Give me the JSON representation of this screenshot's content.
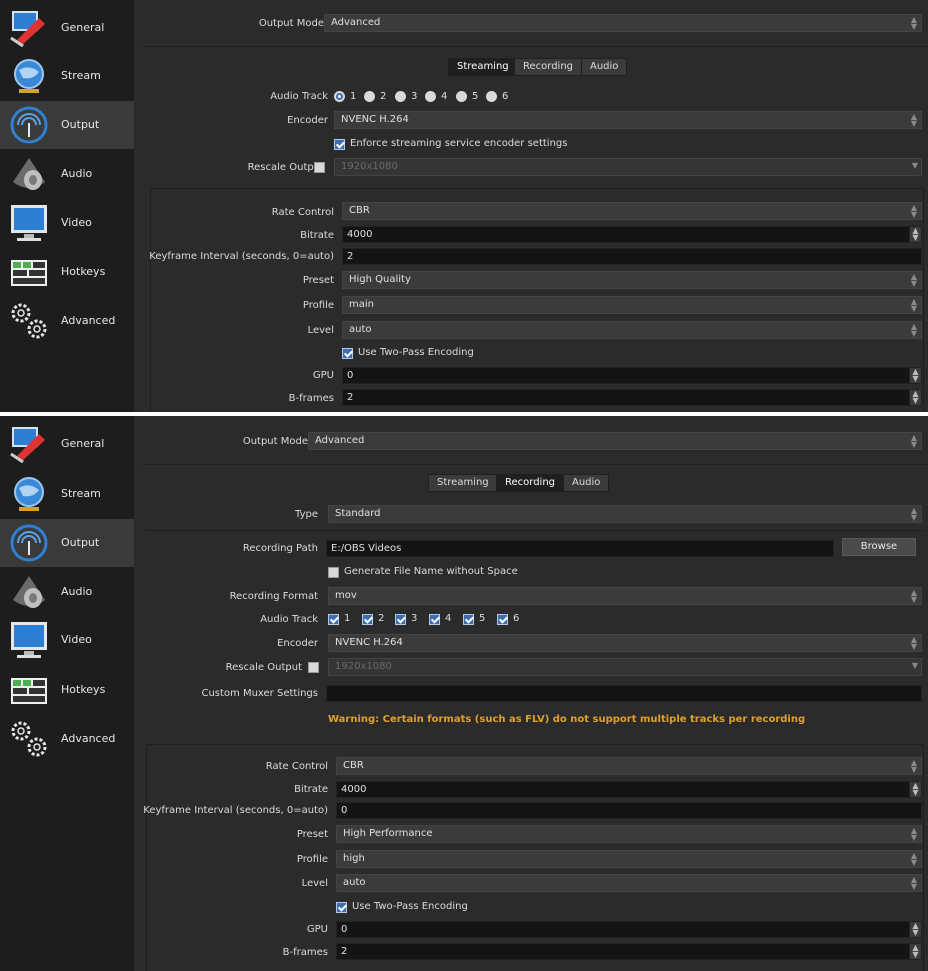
{
  "sidebar": {
    "items": [
      {
        "label": "General",
        "icon": "general-icon"
      },
      {
        "label": "Stream",
        "icon": "stream-icon"
      },
      {
        "label": "Output",
        "icon": "output-icon"
      },
      {
        "label": "Audio",
        "icon": "audio-icon"
      },
      {
        "label": "Video",
        "icon": "video-icon"
      },
      {
        "label": "Hotkeys",
        "icon": "hotkeys-icon"
      },
      {
        "label": "Advanced",
        "icon": "advanced-icon"
      }
    ],
    "active": "Output"
  },
  "streaming_panel": {
    "output_mode_label": "Output Mode",
    "output_mode_value": "Advanced",
    "tabs": [
      "Streaming",
      "Recording",
      "Audio"
    ],
    "active_tab": "Streaming",
    "audio_track_label": "Audio Track",
    "audio_tracks": [
      "1",
      "2",
      "3",
      "4",
      "5",
      "6"
    ],
    "encoder_label": "Encoder",
    "encoder_value": "NVENC H.264",
    "enforce_label": "Enforce streaming service encoder settings",
    "rescale_label": "Rescale Output",
    "rescale_value": "1920x1080",
    "rate_control_label": "Rate Control",
    "rate_control_value": "CBR",
    "bitrate_label": "Bitrate",
    "bitrate_value": "4000",
    "keyframe_label": "Keyframe Interval (seconds, 0=auto)",
    "keyframe_value": "2",
    "preset_label": "Preset",
    "preset_value": "High Quality",
    "profile_label": "Profile",
    "profile_value": "main",
    "level_label": "Level",
    "level_value": "auto",
    "two_pass_label": "Use Two-Pass Encoding",
    "gpu_label": "GPU",
    "gpu_value": "0",
    "bframes_label": "B-frames",
    "bframes_value": "2"
  },
  "recording_panel": {
    "output_mode_label": "Output Mode",
    "output_mode_value": "Advanced",
    "tabs": [
      "Streaming",
      "Recording",
      "Audio"
    ],
    "active_tab": "Recording",
    "type_label": "Type",
    "type_value": "Standard",
    "recording_path_label": "Recording Path",
    "recording_path_value": "E:/OBS Videos",
    "browse_label": "Browse",
    "generate_name_label": "Generate File Name without Space",
    "recording_format_label": "Recording Format",
    "recording_format_value": "mov",
    "audio_track_label": "Audio Track",
    "audio_tracks": [
      "1",
      "2",
      "3",
      "4",
      "5",
      "6"
    ],
    "encoder_label": "Encoder",
    "encoder_value": "NVENC H.264",
    "rescale_label": "Rescale Output",
    "rescale_value": "1920x1080",
    "muxer_label": "Custom Muxer Settings",
    "muxer_value": "",
    "warning_text": "Warning: Certain formats (such as FLV) do not support multiple tracks per recording",
    "rate_control_label": "Rate Control",
    "rate_control_value": "CBR",
    "bitrate_label": "Bitrate",
    "bitrate_value": "4000",
    "keyframe_label": "Keyframe Interval (seconds, 0=auto)",
    "keyframe_value": "0",
    "preset_label": "Preset",
    "preset_value": "High Performance",
    "profile_label": "Profile",
    "profile_value": "high",
    "level_label": "Level",
    "level_value": "auto",
    "two_pass_label": "Use Two-Pass Encoding",
    "gpu_label": "GPU",
    "gpu_value": "0",
    "bframes_label": "B-frames",
    "bframes_value": "2"
  },
  "colors": {
    "background": "#2b2b2b",
    "sidebar": "#1d1d1d",
    "active_item": "#3a3a3a",
    "accent": "#3a6fb4",
    "warning": "#e0a030"
  }
}
